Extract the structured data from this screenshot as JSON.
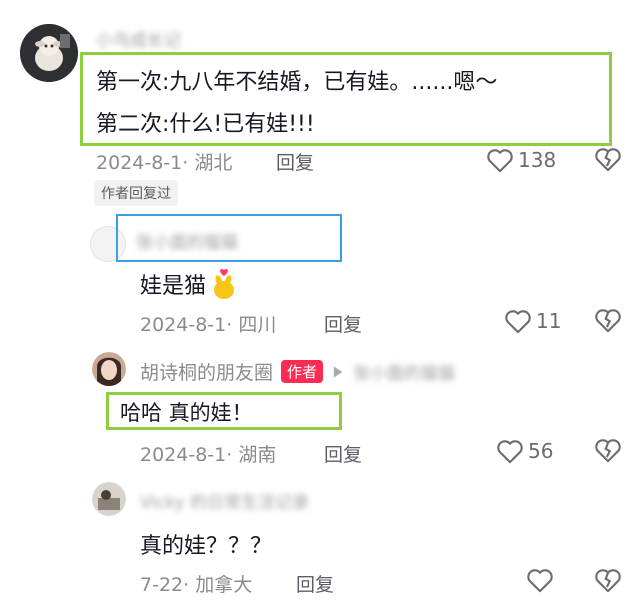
{
  "comments": [
    {
      "username": "小鸟成长记",
      "lines": [
        "第一次:九八年不结婚，已有娃。......嗯～",
        "第二次:什么!已有娃!!!"
      ],
      "date": "2024-8-1",
      "location": "湖北",
      "reply_label": "回复",
      "likes": "138",
      "badge": "作者回复过"
    },
    {
      "username": "张小面的猫猫",
      "text": "娃是猫",
      "date": "2024-8-1",
      "location": "四川",
      "reply_label": "回复",
      "likes": "11"
    },
    {
      "username": "胡诗桐的朋友圈",
      "author_badge": "作者",
      "reply_to": "张小面的猫猫",
      "text": "哈哈 真的娃！",
      "date": "2024-8-1",
      "location": "湖南",
      "reply_label": "回复",
      "likes": "56"
    },
    {
      "username": "Vicky 的日常生活记录",
      "text": "真的娃？？？",
      "date": "7-22",
      "location": "加拿大",
      "reply_label": "回复",
      "likes": ""
    }
  ],
  "colors": {
    "highlight_green": "#8fce3f",
    "highlight_blue": "#3a9fe2",
    "author_badge": "#fe2c55",
    "meta_gray": "#8a8b91"
  },
  "icons": {
    "like": "heart-outline-icon",
    "dislike": "broken-heart-icon",
    "emoji": "finger-heart-emoji",
    "arrow": "play-arrow-icon"
  }
}
